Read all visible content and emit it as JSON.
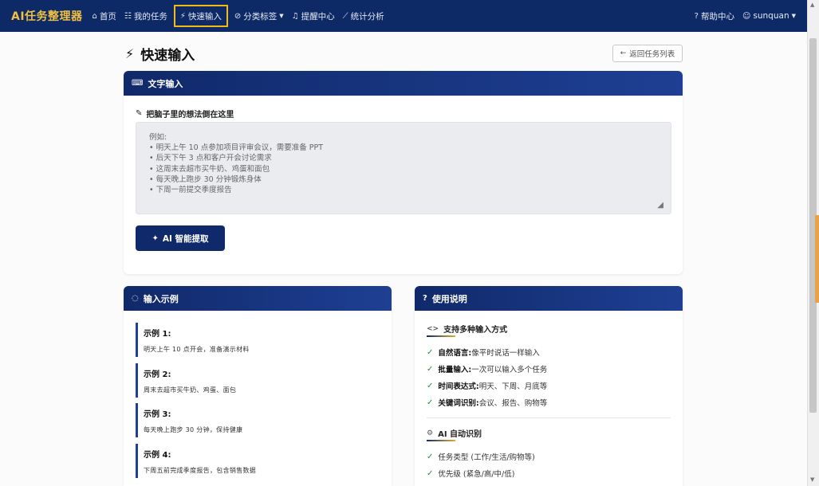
{
  "nav": {
    "brand": "AI任务整理器",
    "items": [
      {
        "icon": "⌂",
        "label": "首页"
      },
      {
        "icon": "☷",
        "label": "我的任务"
      },
      {
        "icon": "⚡",
        "label": "快速输入"
      },
      {
        "icon": "⊘",
        "label": "分类标签"
      },
      {
        "icon": "♫",
        "label": "提醒中心"
      },
      {
        "icon": "⟋",
        "label": "统计分析"
      }
    ],
    "help": {
      "icon": "?",
      "label": "帮助中心"
    },
    "user": {
      "icon": "☺",
      "label": "sunquan"
    }
  },
  "page": {
    "title_icon": "⚡",
    "title": "快速输入",
    "back_icon": "←",
    "back_label": "返回任务列表"
  },
  "text_input": {
    "header_icon": "⌨",
    "header": "文字输入",
    "label_icon": "✎",
    "label": "把脑子里的想法倒在这里",
    "placeholder": "例如:\n• 明天上午 10 点参加项目评审会议，需要准备 PPT\n• 后天下午 3 点和客户开会讨论需求\n• 这周末去超市买牛奶、鸡蛋和面包\n• 每天晚上跑步 30 分钟锻炼身体\n• 下周一前提交季度报告",
    "button_icon": "✦",
    "button": "AI 智能提取"
  },
  "examples": {
    "header_icon": "◌",
    "header": "输入示例",
    "items": [
      {
        "title": "示例 1:",
        "text": "明天上午 10 点开会，准备演示材料"
      },
      {
        "title": "示例 2:",
        "text": "周末去超市买牛奶、鸡蛋、面包"
      },
      {
        "title": "示例 3:",
        "text": "每天晚上跑步 30 分钟，保持健康"
      },
      {
        "title": "示例 4:",
        "text": "下周五前完成季度报告，包含销售数据"
      }
    ]
  },
  "help": {
    "header_icon": "?",
    "header": "使用说明",
    "section1": {
      "icon": "<>",
      "title": "支持多种输入方式",
      "items": [
        {
          "bold": "自然语言:",
          "text": " 像平时说话一样输入"
        },
        {
          "bold": "批量输入:",
          "text": " 一次可以输入多个任务"
        },
        {
          "bold": "时间表达式:",
          "text": " 明天、下周、月底等"
        },
        {
          "bold": "关键词识别:",
          "text": " 会议、报告、购物等"
        }
      ]
    },
    "section2": {
      "icon": "⚙",
      "title": "AI 自动识别",
      "items": [
        {
          "text": "任务类型 (工作/生活/购物等)"
        },
        {
          "text": "优先级 (紧急/高/中/低)"
        }
      ]
    }
  },
  "colors": {
    "nav_bg": "#0e2a66",
    "brand": "#f0c040",
    "highlight": "#f5b914",
    "card_header": "#10296a",
    "check": "#1e8e3e"
  }
}
